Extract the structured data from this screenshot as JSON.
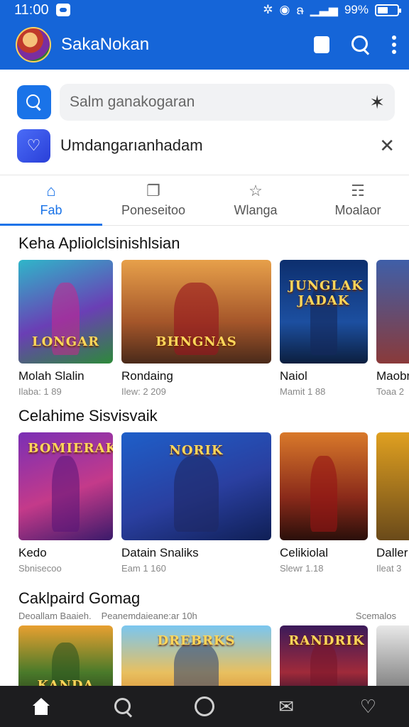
{
  "status_bar": {
    "time": "11:00",
    "signal_text": "ຨ",
    "battery": "99%"
  },
  "app_bar": {
    "title": "SakaNokan"
  },
  "search": {
    "placeholder": "Salm ganakogaran",
    "trailing_glyph": "✶"
  },
  "banner": {
    "text": "Umdangarıanhadam"
  },
  "tabs": [
    {
      "label": "Fab",
      "icon": "bag-icon",
      "glyph": "⌂",
      "active": true
    },
    {
      "label": "Poneseitoo",
      "icon": "share-icon",
      "glyph": "❐",
      "active": false
    },
    {
      "label": "Wlanga",
      "icon": "star-icon",
      "glyph": "☆",
      "active": false
    },
    {
      "label": "Moalaor",
      "icon": "person-icon",
      "glyph": "☶",
      "active": false
    }
  ],
  "sections": [
    {
      "title": "Keha Apliolclsinishlsian",
      "cards": [
        {
          "title": "Molah Slalin",
          "sub": "Ilaba: 1 89",
          "logo": "LONGAR"
        },
        {
          "title": "Rondaing",
          "sub": "Ilew: 2 209",
          "logo": "BHNGNAS"
        },
        {
          "title": "Naiol",
          "sub": "Mamit 1 88",
          "logo": "JUNGLAK JADAK"
        },
        {
          "title": "Maobr",
          "sub": "Toaa 2",
          "logo": ""
        }
      ]
    },
    {
      "title": "Celahime Sisvisvaik",
      "cards": [
        {
          "title": "Kedo",
          "sub": "Sbnisecoo",
          "logo": "BOMIERAK"
        },
        {
          "title": "Datain Snaliks",
          "sub": "Eam 1 160",
          "logo": "NORIK"
        },
        {
          "title": "Celikiolal",
          "sub": "Slewr 1.18",
          "logo": ""
        },
        {
          "title": "Daller",
          "sub": "Ileat 3",
          "logo": ""
        }
      ]
    },
    {
      "title": "Caklpaird Gomag",
      "header_left": "Deoallam Baaieh.",
      "header_mid": "Peanemdaieane:ar 10h",
      "header_right": "Scemalos",
      "cards": [
        {
          "title": "",
          "sub": "",
          "logo": "KANDA"
        },
        {
          "title": "",
          "sub": "",
          "logo": "DREBRKS"
        },
        {
          "title": "",
          "sub": "",
          "logo": "RANDRIK"
        },
        {
          "title": "",
          "sub": "",
          "logo": ""
        }
      ]
    }
  ],
  "bottom_nav": [
    {
      "name": "home-icon",
      "active": true
    },
    {
      "name": "search-icon",
      "active": false
    },
    {
      "name": "compass-icon",
      "active": false
    },
    {
      "name": "inbox-icon",
      "active": false
    },
    {
      "name": "heart-icon",
      "active": false
    }
  ],
  "colors": {
    "brand": "#1565d8",
    "accent": "#1a73e8",
    "nav_bg": "#1d1d1f"
  }
}
